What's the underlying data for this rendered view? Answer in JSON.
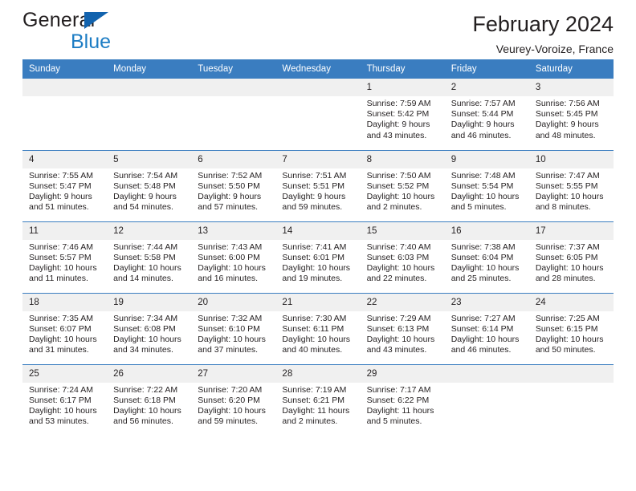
{
  "brand": {
    "name_top": "General",
    "name_bottom": "Blue",
    "triangle_color": "#1263ae",
    "blue_text_color": "#1d7dc4"
  },
  "header": {
    "title": "February 2024",
    "subtitle": "Veurey-Voroize, France"
  },
  "theme": {
    "header_blue": "#3a7dc0",
    "daynum_bg": "#f0f0f0",
    "text": "#231f20"
  },
  "calendar": {
    "weekday_headers": [
      "Sunday",
      "Monday",
      "Tuesday",
      "Wednesday",
      "Thursday",
      "Friday",
      "Saturday"
    ],
    "weeks": [
      [
        {
          "day": "",
          "empty": true,
          "sunrise": "",
          "sunset": "",
          "daylight1": "",
          "daylight2": ""
        },
        {
          "day": "",
          "empty": true,
          "sunrise": "",
          "sunset": "",
          "daylight1": "",
          "daylight2": ""
        },
        {
          "day": "",
          "empty": true,
          "sunrise": "",
          "sunset": "",
          "daylight1": "",
          "daylight2": ""
        },
        {
          "day": "",
          "empty": true,
          "sunrise": "",
          "sunset": "",
          "daylight1": "",
          "daylight2": ""
        },
        {
          "day": "1",
          "empty": false,
          "sunrise": "Sunrise: 7:59 AM",
          "sunset": "Sunset: 5:42 PM",
          "daylight1": "Daylight: 9 hours",
          "daylight2": "and 43 minutes."
        },
        {
          "day": "2",
          "empty": false,
          "sunrise": "Sunrise: 7:57 AM",
          "sunset": "Sunset: 5:44 PM",
          "daylight1": "Daylight: 9 hours",
          "daylight2": "and 46 minutes."
        },
        {
          "day": "3",
          "empty": false,
          "sunrise": "Sunrise: 7:56 AM",
          "sunset": "Sunset: 5:45 PM",
          "daylight1": "Daylight: 9 hours",
          "daylight2": "and 48 minutes."
        }
      ],
      [
        {
          "day": "4",
          "empty": false,
          "sunrise": "Sunrise: 7:55 AM",
          "sunset": "Sunset: 5:47 PM",
          "daylight1": "Daylight: 9 hours",
          "daylight2": "and 51 minutes."
        },
        {
          "day": "5",
          "empty": false,
          "sunrise": "Sunrise: 7:54 AM",
          "sunset": "Sunset: 5:48 PM",
          "daylight1": "Daylight: 9 hours",
          "daylight2": "and 54 minutes."
        },
        {
          "day": "6",
          "empty": false,
          "sunrise": "Sunrise: 7:52 AM",
          "sunset": "Sunset: 5:50 PM",
          "daylight1": "Daylight: 9 hours",
          "daylight2": "and 57 minutes."
        },
        {
          "day": "7",
          "empty": false,
          "sunrise": "Sunrise: 7:51 AM",
          "sunset": "Sunset: 5:51 PM",
          "daylight1": "Daylight: 9 hours",
          "daylight2": "and 59 minutes."
        },
        {
          "day": "8",
          "empty": false,
          "sunrise": "Sunrise: 7:50 AM",
          "sunset": "Sunset: 5:52 PM",
          "daylight1": "Daylight: 10 hours",
          "daylight2": "and 2 minutes."
        },
        {
          "day": "9",
          "empty": false,
          "sunrise": "Sunrise: 7:48 AM",
          "sunset": "Sunset: 5:54 PM",
          "daylight1": "Daylight: 10 hours",
          "daylight2": "and 5 minutes."
        },
        {
          "day": "10",
          "empty": false,
          "sunrise": "Sunrise: 7:47 AM",
          "sunset": "Sunset: 5:55 PM",
          "daylight1": "Daylight: 10 hours",
          "daylight2": "and 8 minutes."
        }
      ],
      [
        {
          "day": "11",
          "empty": false,
          "sunrise": "Sunrise: 7:46 AM",
          "sunset": "Sunset: 5:57 PM",
          "daylight1": "Daylight: 10 hours",
          "daylight2": "and 11 minutes."
        },
        {
          "day": "12",
          "empty": false,
          "sunrise": "Sunrise: 7:44 AM",
          "sunset": "Sunset: 5:58 PM",
          "daylight1": "Daylight: 10 hours",
          "daylight2": "and 14 minutes."
        },
        {
          "day": "13",
          "empty": false,
          "sunrise": "Sunrise: 7:43 AM",
          "sunset": "Sunset: 6:00 PM",
          "daylight1": "Daylight: 10 hours",
          "daylight2": "and 16 minutes."
        },
        {
          "day": "14",
          "empty": false,
          "sunrise": "Sunrise: 7:41 AM",
          "sunset": "Sunset: 6:01 PM",
          "daylight1": "Daylight: 10 hours",
          "daylight2": "and 19 minutes."
        },
        {
          "day": "15",
          "empty": false,
          "sunrise": "Sunrise: 7:40 AM",
          "sunset": "Sunset: 6:03 PM",
          "daylight1": "Daylight: 10 hours",
          "daylight2": "and 22 minutes."
        },
        {
          "day": "16",
          "empty": false,
          "sunrise": "Sunrise: 7:38 AM",
          "sunset": "Sunset: 6:04 PM",
          "daylight1": "Daylight: 10 hours",
          "daylight2": "and 25 minutes."
        },
        {
          "day": "17",
          "empty": false,
          "sunrise": "Sunrise: 7:37 AM",
          "sunset": "Sunset: 6:05 PM",
          "daylight1": "Daylight: 10 hours",
          "daylight2": "and 28 minutes."
        }
      ],
      [
        {
          "day": "18",
          "empty": false,
          "sunrise": "Sunrise: 7:35 AM",
          "sunset": "Sunset: 6:07 PM",
          "daylight1": "Daylight: 10 hours",
          "daylight2": "and 31 minutes."
        },
        {
          "day": "19",
          "empty": false,
          "sunrise": "Sunrise: 7:34 AM",
          "sunset": "Sunset: 6:08 PM",
          "daylight1": "Daylight: 10 hours",
          "daylight2": "and 34 minutes."
        },
        {
          "day": "20",
          "empty": false,
          "sunrise": "Sunrise: 7:32 AM",
          "sunset": "Sunset: 6:10 PM",
          "daylight1": "Daylight: 10 hours",
          "daylight2": "and 37 minutes."
        },
        {
          "day": "21",
          "empty": false,
          "sunrise": "Sunrise: 7:30 AM",
          "sunset": "Sunset: 6:11 PM",
          "daylight1": "Daylight: 10 hours",
          "daylight2": "and 40 minutes."
        },
        {
          "day": "22",
          "empty": false,
          "sunrise": "Sunrise: 7:29 AM",
          "sunset": "Sunset: 6:13 PM",
          "daylight1": "Daylight: 10 hours",
          "daylight2": "and 43 minutes."
        },
        {
          "day": "23",
          "empty": false,
          "sunrise": "Sunrise: 7:27 AM",
          "sunset": "Sunset: 6:14 PM",
          "daylight1": "Daylight: 10 hours",
          "daylight2": "and 46 minutes."
        },
        {
          "day": "24",
          "empty": false,
          "sunrise": "Sunrise: 7:25 AM",
          "sunset": "Sunset: 6:15 PM",
          "daylight1": "Daylight: 10 hours",
          "daylight2": "and 50 minutes."
        }
      ],
      [
        {
          "day": "25",
          "empty": false,
          "sunrise": "Sunrise: 7:24 AM",
          "sunset": "Sunset: 6:17 PM",
          "daylight1": "Daylight: 10 hours",
          "daylight2": "and 53 minutes."
        },
        {
          "day": "26",
          "empty": false,
          "sunrise": "Sunrise: 7:22 AM",
          "sunset": "Sunset: 6:18 PM",
          "daylight1": "Daylight: 10 hours",
          "daylight2": "and 56 minutes."
        },
        {
          "day": "27",
          "empty": false,
          "sunrise": "Sunrise: 7:20 AM",
          "sunset": "Sunset: 6:20 PM",
          "daylight1": "Daylight: 10 hours",
          "daylight2": "and 59 minutes."
        },
        {
          "day": "28",
          "empty": false,
          "sunrise": "Sunrise: 7:19 AM",
          "sunset": "Sunset: 6:21 PM",
          "daylight1": "Daylight: 11 hours",
          "daylight2": "and 2 minutes."
        },
        {
          "day": "29",
          "empty": false,
          "sunrise": "Sunrise: 7:17 AM",
          "sunset": "Sunset: 6:22 PM",
          "daylight1": "Daylight: 11 hours",
          "daylight2": "and 5 minutes."
        },
        {
          "day": "",
          "empty": true,
          "sunrise": "",
          "sunset": "",
          "daylight1": "",
          "daylight2": ""
        },
        {
          "day": "",
          "empty": true,
          "sunrise": "",
          "sunset": "",
          "daylight1": "",
          "daylight2": ""
        }
      ]
    ]
  }
}
